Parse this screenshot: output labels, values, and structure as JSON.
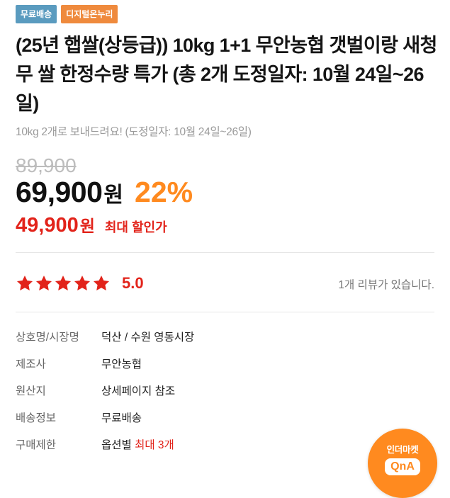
{
  "badges": [
    {
      "label": "무료배송",
      "color": "#5a9bbf"
    },
    {
      "label": "디지털온누리",
      "color": "#ef8a3d"
    }
  ],
  "product": {
    "title": "(25년 햅쌀(상등급)) 10kg 1+1 무안농협 갯벌이랑 새청무 쌀 한정수량 특가 (총 2개 도정일자: 10월 24일~26일)",
    "subtitle": "10kg 2개로 보내드려요! (도정일자: 10월 24일~26일)"
  },
  "pricing": {
    "original_price": "89,900",
    "sale_price": "69,900",
    "currency_unit": "원",
    "discount": "22%",
    "max_discount_price": "49,900",
    "max_discount_label": "최대 할인가"
  },
  "rating": {
    "value": "5.0",
    "stars": 5,
    "review_count_text": "1개 리뷰가 있습니다."
  },
  "info": {
    "rows": [
      {
        "label": "상호명/시장명",
        "value": "덕산 / 수원 영동시장"
      },
      {
        "label": "제조사",
        "value": "무안농협"
      },
      {
        "label": "원산지",
        "value": "상세페이지 참조"
      },
      {
        "label": "배송정보",
        "value": "무료배송"
      },
      {
        "label": "구매제한",
        "value": "옵션별",
        "value_highlight": "최대 3개"
      }
    ]
  },
  "qna": {
    "top": "인더마켓",
    "bottom": "QnA"
  },
  "colors": {
    "accent_red": "#e2231a",
    "accent_orange": "#ff8a1f",
    "star": "#e2231a"
  }
}
